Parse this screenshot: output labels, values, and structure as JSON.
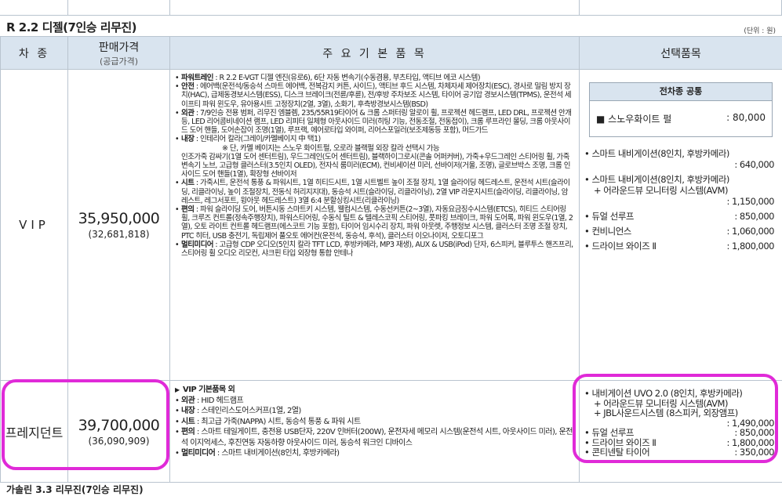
{
  "section": {
    "title": "R 2.2 디젤(7인승 리무진)",
    "unit": "(단위 : 원)",
    "next_title": "가솔린 3.3 리무진(7인승 리무진)"
  },
  "headers": {
    "model": "차 종",
    "price": "판매가격",
    "price_sub": "(공급가격)",
    "features": "주 요 기 본 품 목",
    "options": "선택품목"
  },
  "vip": {
    "model": "VIP",
    "price": "35,950,000",
    "supply": "(32,681,818)",
    "features": [
      {
        "label": "파워트레인",
        "text": " : R 2.2 E-VGT 디젤 엔진(유로6), 6단 자동 변속기(수동겸용, 부츠타입, 액티브 에코 시스템)"
      },
      {
        "label": "안전",
        "text": " : 에어백(운전석/동승석 스마트 에어백, 전복감지 커튼, 사이드), 액티브 후드 시스템, 차체자세 제어장치(ESC), 경사로 밀림 방지 장치(HAC), 급제동경보시스템(ESS), 디스크 브레이크(전륜/후륜), 전/후방 주차보조 시스템, 타이어 공기압 경보시스템(TPMS), 운전석 세이프티 파워 윈도우, 유아용시트 고정장치(2열, 3열), 소화기, 후측방경보시스템(BSD)"
      },
      {
        "label": "외관",
        "text": " : 7/9인승 전용 범퍼, 리무진 엠블렘, 235/55R19타이어 & 크롬 스퍼터링 알로이 휠, 프로젝션 헤드램프, LED DRL, 프로젝션 안개등, LED 리어콤비네이션 램프, LED 리피터 일체형 아웃사이드 미러(히팅 기능, 전동조절, 전동접이), 크롬 루프라인 몰딩, 크롬 아웃사이드 도어 핸들, 도어손잡이 조명(1열), 루프랙, 에어로타입 와이퍼, 리어스포일러(보조제동등 포함), 머드가드"
      },
      {
        "label": "내장",
        "text": " : 인테리어 칼라(그레이/카멜베이지 中 택1)"
      },
      {
        "note": "※ 단, 카멜 베이지는 스노우 화이트펄, 오로라 블랙펄 외장 칼라 선택시 가능"
      },
      {
        "plain": "인조가죽 감싸기(1열 도어 센터트림), 우드그레인(도어 센터트림), 블랙하이그로시(콘솔 어퍼커버), 가죽+우드그레인 스티어링 휠, 가죽 변속기 노브, 고급형 클러스터(3.5인치 OLED), 전자식 룸미러(ECM), 컨비세이션 미러, 선바이저(거울, 조명), 글로브박스 조명, 크롬 인사이드 도어 핸들(1열), 확장형 선바이저"
      },
      {
        "label": "시트",
        "text": " : 가죽시트, 운전석 통풍 & 파워시트, 1열 히티드시트, 1열 시트벨트 높이 조절 장치, 1열 슬라이딩 헤드레스트, 운전석 시트(슬라이딩, 리클라이닝, 높이 조절장치, 전동식 허리지지대), 동승석 시트(슬라이딩, 리클라이닝), 2열 VIP 라운지시트(슬라이딩, 리클라이닝, 암레스트, 레그서포트, 윙아웃 헤드레스트) 3열 6:4 분할싱킹시트(리클라이닝)"
      },
      {
        "label": "편의",
        "text": " : 파워 슬라이딩 도어, 버튼시동 스마트키 시스템, 웰컴시스템, 수동선커튼(2~3열), 자동요금징수시스템(ETCS), 히티드 스티어링 휠, 크루즈 컨트롤(정속주행장치), 파워스티어링, 수동식 틸트 & 텔레스코픽 스티어링, 풋파킹 브레이크, 파워 도어록, 파워 윈도우(1열, 2열), 오토 라이트 컨트롤 헤드램프(에스코트 기능 포함), 타이어 임시수리 장치, 파워 아웃렛, 주행정보 시스템, 클러스터 조명 조절 장치, PTC 히터, USB 충전기, 독립제어 풀오토 에어컨(운전석, 동승석, 후석), 클러스터 이오나이저, 오토디포그"
      },
      {
        "label": "멀티미디어",
        "text": " : 고급형 CDP 오디오(5인치 칼라 TFT LCD, 후방카메라, MP3 재생), AUX & USB(iPod) 단자, 6스피커, 블루투스 핸즈프리, 스티어링 휠 오디오 리모컨, 샤크핀 타입 외장형 통합 안테나"
      }
    ],
    "common_header": "전차종 공통",
    "common_item": "■ 스노우화이트 펄",
    "common_price": ": 80,000",
    "options": [
      {
        "name": "스마트 내비게이션(8인치, 후방카메라)",
        "price": ": 640,000",
        "break": true
      },
      {
        "name": "스마트 내비게이션(8인치, 후방카메라)",
        "name2": "+ 어라운드뷰 모니터링 시스템(AVM)",
        "price": ": 1,150,000",
        "break": true
      },
      {
        "name": "듀얼 선루프",
        "price": ": 850,000"
      },
      {
        "name": "컨비니언스",
        "price": ": 1,060,000"
      },
      {
        "name": "드라이브 와이즈 Ⅱ",
        "price": ": 1,800,000"
      }
    ]
  },
  "president": {
    "model": "프레지던트",
    "price": "39,700,000",
    "supply": "(36,090,909)",
    "features": [
      {
        "head": "VIP 기본품목 외"
      },
      {
        "label": "외관",
        "text": " : HID 헤드램프"
      },
      {
        "label": "내장",
        "text": " : 스테인리스도어스커프(1열, 2열)"
      },
      {
        "label": "시트",
        "text": " : 최고급 가죽(NAPPA) 시트, 동승석 통풍 & 파워 시트"
      },
      {
        "label": "편의",
        "text": " : 스마트 테일게이트, 충전용 USB단자, 220V 인버터(200W), 운전자세 메모리 시스템(운전석 시트, 아웃사이드 미러), 운전석 이지억세스, 후진연동 자동하향 아웃사이드 미러, 동승석 워크인 디바이스"
      },
      {
        "label": "멀티미디어",
        "text": " : 스마트 내비게이션(8인치, 후방카메라)"
      }
    ],
    "options": {
      "nav": "• 내비게이션 UVO 2.0 (8인치, 후방카메라)",
      "nav2": "+ 어라운드뷰 모니터링 시스템(AVM)",
      "nav3": "+ JBL사운드시스템 (8스피커, 외장앰프)",
      "nav_price": ": 1,490,000",
      "sunroof": "• 듀얼 선루프",
      "sunroof_price": ": 850,000",
      "drive": "• 드라이브 와이즈 Ⅱ",
      "drive_price": ": 1,800,000",
      "tire": "• 콘티넨탈 타이어",
      "tire_price": ": 350,000"
    }
  },
  "colors": {
    "header_bg": "#d9e4ef",
    "border": "#b9c4cf",
    "highlight": "#e02ad8"
  }
}
